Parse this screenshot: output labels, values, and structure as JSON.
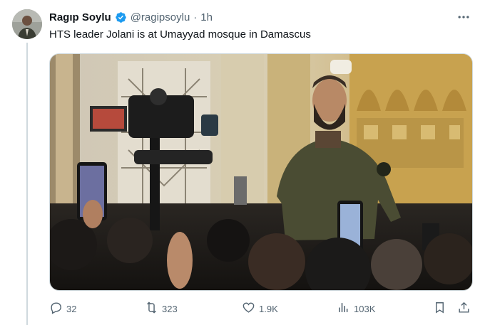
{
  "author": {
    "display_name": "Ragıp Soylu",
    "handle": "@ragipsoylu",
    "separator": "·",
    "time": "1h",
    "verified": true
  },
  "tweet": {
    "text": "HTS leader Jolani is at Umayyad mosque in Damascus"
  },
  "media": {
    "type": "photo"
  },
  "actions": {
    "replies": "32",
    "reposts": "323",
    "likes": "1.9K",
    "views": "103K"
  },
  "icons": [
    "verified-badge-icon",
    "more-icon",
    "reply-icon",
    "repost-icon",
    "like-icon",
    "views-icon",
    "bookmark-icon",
    "share-icon"
  ],
  "colors": {
    "verified": "#1d9bf0",
    "secondary_text": "#536471",
    "primary_text": "#0f1419"
  }
}
